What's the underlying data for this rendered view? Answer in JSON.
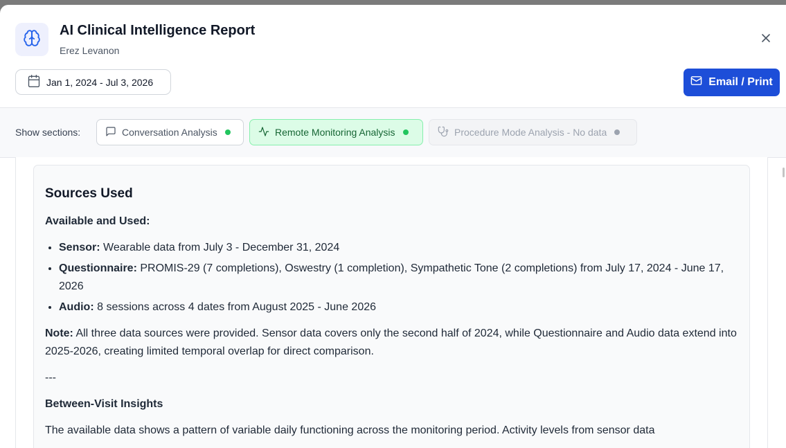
{
  "header": {
    "title": "AI Clinical Intelligence Report",
    "patient_name": "Erez Levanon",
    "date_range": "Jan 1, 2024 - Jul 3, 2026",
    "email_print_label": "Email / Print",
    "icons": {
      "logo": "brain-icon",
      "close": "close-icon",
      "date": "calendar-icon",
      "email": "mail-icon"
    },
    "colors": {
      "primary": "#1d4ed8",
      "logo_bg": "#eef0fd"
    }
  },
  "sections": {
    "label": "Show sections:",
    "chips": [
      {
        "label": "Conversation Analysis",
        "icon": "message-square-icon",
        "status": "available",
        "active": false
      },
      {
        "label": "Remote Monitoring Analysis",
        "icon": "activity-icon",
        "status": "available",
        "active": true
      },
      {
        "label": "Procedure Mode Analysis - No data",
        "icon": "stethoscope-icon",
        "status": "no-data",
        "active": false
      }
    ],
    "colors": {
      "available_dot": "#22c55e",
      "active_bg": "#dcfce7",
      "no_data_dot": "#9ca3af"
    }
  },
  "report": {
    "sources_title": "Sources Used",
    "available_heading": "Available and Used:",
    "sources": [
      {
        "label": "Sensor:",
        "text": " Wearable data from July 3 - December 31, 2024"
      },
      {
        "label": "Questionnaire:",
        "text": " PROMIS-29 (7 completions), Oswestry (1 completion), Sympathetic Tone (2 completions) from July 17, 2024 - June 17, 2026"
      },
      {
        "label": "Audio:",
        "text": " 8 sessions across 4 dates from August 2025 - June 2026"
      }
    ],
    "note_label": "Note:",
    "note_text": " All three data sources were provided. Sensor data covers only the second half of 2024, while Questionnaire and Audio data extend into 2025-2026, creating limited temporal overlap for direct comparison.",
    "separator": "---",
    "between_visit_heading": "Between-Visit Insights",
    "between_visit_text": "The available data shows a pattern of variable daily functioning across the monitoring period. Activity levels from sensor data"
  }
}
